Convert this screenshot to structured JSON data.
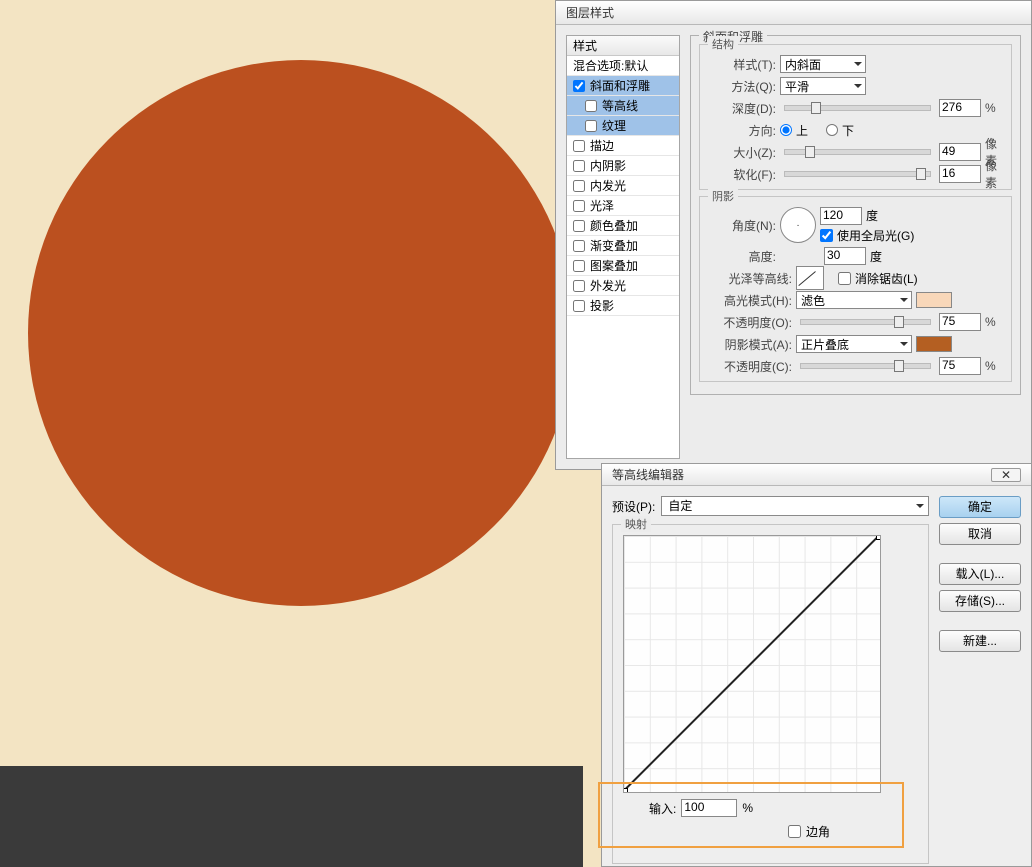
{
  "dialog_title": "图层样式",
  "styles_panel": {
    "header": "样式",
    "blending": "混合选项:默认",
    "bevel": "斜面和浮雕",
    "contour": "等高线",
    "texture": "纹理",
    "stroke": "描边",
    "inner_shadow": "内阴影",
    "inner_glow": "内发光",
    "satin": "光泽",
    "color_overlay": "颜色叠加",
    "gradient_overlay": "渐变叠加",
    "pattern_overlay": "图案叠加",
    "outer_glow": "外发光",
    "drop_shadow": "投影"
  },
  "bevel": {
    "group_label": "斜面和浮雕",
    "structure_label": "结构",
    "style_lab": "样式(T):",
    "style_val": "内斜面",
    "technique_lab": "方法(Q):",
    "technique_val": "平滑",
    "depth_lab": "深度(D):",
    "depth_val": "276",
    "pct": "%",
    "direction_lab": "方向:",
    "up": "上",
    "down": "下",
    "size_lab": "大小(Z):",
    "size_val": "49",
    "px": "像素",
    "soften_lab": "软化(F):",
    "soften_val": "16"
  },
  "shading": {
    "group_label": "阴影",
    "angle_lab": "角度(N):",
    "angle_val": "120",
    "deg": "度",
    "global_light": "使用全局光(G)",
    "altitude_lab": "高度:",
    "altitude_val": "30",
    "gloss_contour_lab": "光泽等高线:",
    "anti_alias": "消除锯齿(L)",
    "highlight_mode_lab": "高光模式(H):",
    "highlight_mode_val": "滤色",
    "opacity_lab_h": "不透明度(O):",
    "opacity_h": "75",
    "shadow_mode_lab": "阴影模式(A):",
    "shadow_mode_val": "正片叠底",
    "opacity_lab_s": "不透明度(C):",
    "opacity_s": "75"
  },
  "contour_editor": {
    "title": "等高线编辑器",
    "preset_lab": "预设(P):",
    "preset_val": "自定",
    "mapping_lab": "映射",
    "input_lab": "输入:",
    "input_val": "100",
    "pct": "%",
    "corner": "边角",
    "ok": "确定",
    "cancel": "取消",
    "load": "载入(L)...",
    "save": "存储(S)...",
    "new": "新建..."
  }
}
